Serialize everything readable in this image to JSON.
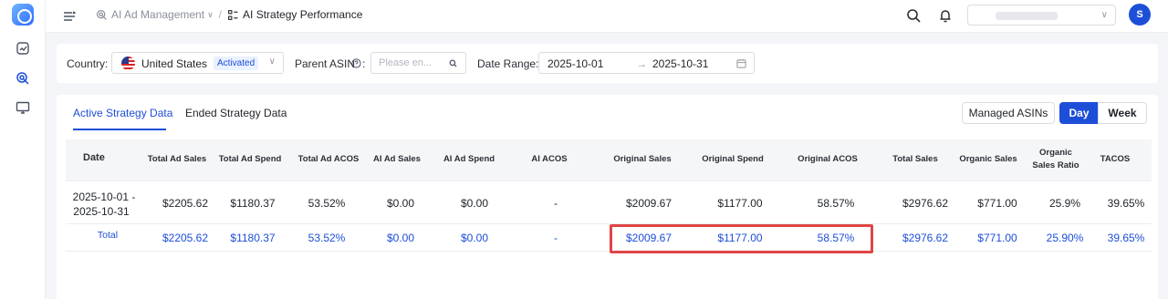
{
  "header": {
    "breadcrumb_parent": "AI Ad Management",
    "breadcrumb_current": "AI Strategy Performance",
    "user_initial": "S"
  },
  "filters": {
    "country_label": "Country:",
    "country_value": "United States",
    "country_status": "Activated",
    "asin_label": "Parent ASIN",
    "asin_placeholder": "Please en...",
    "date_label": "Date Range:",
    "date_start": "2025-10-01",
    "date_end": "2025-10-31"
  },
  "tabs": {
    "active": "Active Strategy Data",
    "ended": "Ended Strategy Data"
  },
  "actions": {
    "managed_asins": "Managed ASINs",
    "day": "Day",
    "week": "Week"
  },
  "table": {
    "headers": {
      "date": "Date",
      "total_ad_sales": "Total Ad Sales",
      "total_ad_spend": "Total Ad Spend",
      "total_ad_acos": "Total Ad ACOS",
      "ai_ad_sales": "AI Ad Sales",
      "ai_ad_spend": "AI Ad Spend",
      "ai_acos": "AI ACOS",
      "original_sales": "Original Sales",
      "original_spend": "Original Spend",
      "original_acos": "Original ACOS",
      "total_sales": "Total Sales",
      "organic_sales": "Organic Sales",
      "organic_ratio_1": "Organic",
      "organic_ratio_2": "Sales Ratio",
      "tacos": "TACOS"
    },
    "row": {
      "date_1": "2025-10-01 -",
      "date_2": "2025-10-31",
      "total_ad_sales": "$2205.62",
      "total_ad_spend": "$1180.37",
      "total_ad_acos": "53.52%",
      "ai_ad_sales": "$0.00",
      "ai_ad_spend": "$0.00",
      "ai_acos": "-",
      "original_sales": "$2009.67",
      "original_spend": "$1177.00",
      "original_acos": "58.57%",
      "total_sales": "$2976.62",
      "organic_sales": "$771.00",
      "organic_ratio": "25.9%",
      "tacos": "39.65%"
    },
    "total": {
      "label": "Total",
      "total_ad_sales": "$2205.62",
      "total_ad_spend": "$1180.37",
      "total_ad_acos": "53.52%",
      "ai_ad_sales": "$0.00",
      "ai_ad_spend": "$0.00",
      "ai_acos": "-",
      "original_sales": "$2009.67",
      "original_spend": "$1177.00",
      "original_acos": "58.57%",
      "total_sales": "$2976.62",
      "organic_sales": "$771.00",
      "organic_ratio": "25.90%",
      "tacos": "39.65%"
    }
  },
  "colors": {
    "accent": "#1d4ed8",
    "highlight": "#e04545"
  },
  "icons": [
    "app-logo-icon",
    "chart-icon",
    "target-icon",
    "monitor-icon",
    "menu-icon",
    "search-icon",
    "bell-icon",
    "question-icon",
    "calendar-icon",
    "chevron-down-icon"
  ]
}
